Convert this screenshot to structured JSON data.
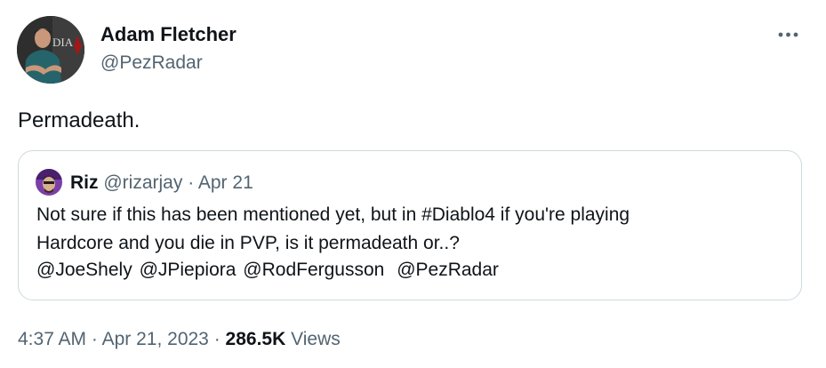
{
  "author": {
    "name": "Adam Fletcher",
    "handle": "@PezRadar",
    "avatar_text": "DIA"
  },
  "tweet": {
    "text": "Permadeath."
  },
  "quoted_tweet": {
    "name": "Riz",
    "handle": "@rizarjay",
    "separator": "·",
    "date": "Apr 21",
    "line1": "Not sure if this has been mentioned yet, but in #Diablo4 if you're playing",
    "line2": "Hardcore and you die in PVP, is it permadeath or..?",
    "mentions": [
      "@JoeShely",
      "@JPiepiora",
      "@RodFergusson",
      "@PezRadar"
    ]
  },
  "meta": {
    "time": "4:37 AM",
    "sep1": "·",
    "date": "Apr 21, 2023",
    "sep2": "·",
    "views_count": "286.5K",
    "views_label": "Views"
  },
  "icons": {
    "more": "more-horizontal-icon"
  },
  "colors": {
    "text_primary": "#0f1419",
    "text_secondary": "#536471",
    "border": "#cfd9de"
  }
}
